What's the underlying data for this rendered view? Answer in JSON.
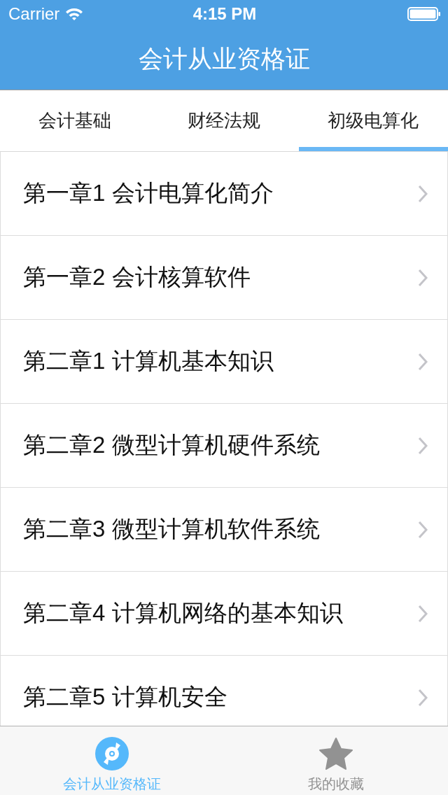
{
  "status_bar": {
    "carrier": "Carrier",
    "time": "4:15 PM"
  },
  "nav_bar": {
    "title": "会计从业资格证"
  },
  "tabs": [
    {
      "label": "会计基础",
      "selected": false
    },
    {
      "label": "财经法规",
      "selected": false
    },
    {
      "label": "初级电算化",
      "selected": true
    }
  ],
  "chapters": [
    {
      "title": "第一章1 会计电算化简介"
    },
    {
      "title": "第一章2 会计核算软件"
    },
    {
      "title": "第二章1 计算机基本知识"
    },
    {
      "title": "第二章2 微型计算机硬件系统"
    },
    {
      "title": "第二章3 微型计算机软件系统"
    },
    {
      "title": "第二章4 计算机网络的基本知识"
    },
    {
      "title": "第二章5 计算机安全"
    }
  ],
  "tab_bar": [
    {
      "label": "会计从业资格证",
      "selected": true
    },
    {
      "label": "我的收藏",
      "selected": false
    }
  ]
}
